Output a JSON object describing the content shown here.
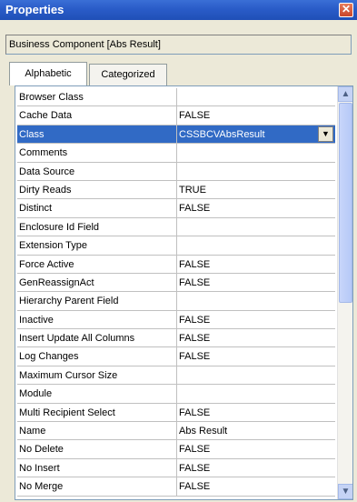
{
  "window": {
    "title": "Properties",
    "close_glyph": "✕"
  },
  "object_selector": {
    "value": "Business Component [Abs Result]"
  },
  "tabs": [
    {
      "label": "Alphabetic",
      "active": true
    },
    {
      "label": "Categorized",
      "active": false
    }
  ],
  "properties": [
    {
      "name": "Browser Class",
      "value": ""
    },
    {
      "name": "Cache Data",
      "value": "FALSE"
    },
    {
      "name": "Class",
      "value": "CSSBCVAbsResult",
      "selected": true
    },
    {
      "name": "Comments",
      "value": ""
    },
    {
      "name": "Data Source",
      "value": ""
    },
    {
      "name": "Dirty Reads",
      "value": "TRUE"
    },
    {
      "name": "Distinct",
      "value": "FALSE"
    },
    {
      "name": "Enclosure Id Field",
      "value": ""
    },
    {
      "name": "Extension Type",
      "value": ""
    },
    {
      "name": "Force Active",
      "value": "FALSE"
    },
    {
      "name": "GenReassignAct",
      "value": "FALSE"
    },
    {
      "name": "Hierarchy Parent Field",
      "value": ""
    },
    {
      "name": "Inactive",
      "value": "FALSE"
    },
    {
      "name": "Insert Update All Columns",
      "value": "FALSE"
    },
    {
      "name": "Log Changes",
      "value": "FALSE"
    },
    {
      "name": "Maximum Cursor Size",
      "value": ""
    },
    {
      "name": "Module",
      "value": ""
    },
    {
      "name": "Multi Recipient Select",
      "value": "FALSE"
    },
    {
      "name": "Name",
      "value": "Abs Result"
    },
    {
      "name": "No Delete",
      "value": "FALSE"
    },
    {
      "name": "No Insert",
      "value": "FALSE"
    },
    {
      "name": "No Merge",
      "value": "FALSE"
    }
  ],
  "scrollbar": {
    "up_glyph": "▲",
    "down_glyph": "▼"
  },
  "dropdown_glyph": "▼",
  "colors": {
    "title_bar": "#2a5cc8",
    "selection": "#316ac5",
    "panel": "#ece9d8"
  }
}
